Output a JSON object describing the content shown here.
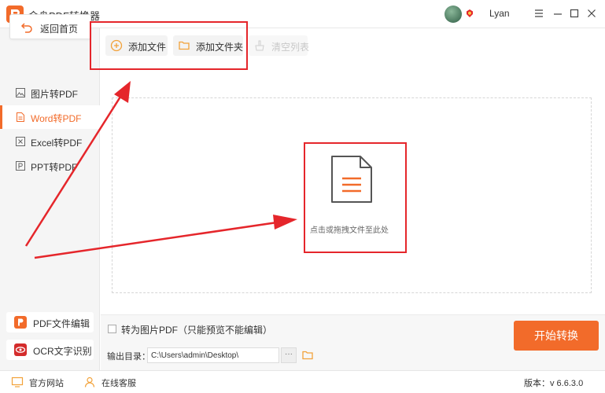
{
  "app": {
    "title": "金舟PDF转换器",
    "user": "Lyan",
    "version_label": "版本：",
    "version": "v 6.6.3.0"
  },
  "sidebar": {
    "back": "返回首页",
    "items": [
      {
        "label": "图片转PDF",
        "icon": "image-icon"
      },
      {
        "label": "Word转PDF",
        "icon": "word-doc-icon",
        "active": true
      },
      {
        "label": "Excel转PDF",
        "icon": "excel-icon"
      },
      {
        "label": "PPT转PDF",
        "icon": "ppt-icon"
      }
    ],
    "tools": [
      {
        "label": "PDF文件编辑",
        "icon": "pdf-edit-icon"
      },
      {
        "label": "OCR文字识别",
        "icon": "ocr-eye-icon"
      }
    ]
  },
  "toolbar": {
    "add_file": "添加文件",
    "add_folder": "添加文件夹",
    "clear_list": "清空列表"
  },
  "drop": {
    "text": "点击或拖拽文件至此处"
  },
  "options": {
    "to_image_pdf": "转为图片PDF（只能预览不能编辑）",
    "output_label": "输出目录：",
    "output_path": "C:\\Users\\admin\\Desktop\\",
    "browse": "···",
    "start": "开始转换"
  },
  "status": {
    "website": "官方网站",
    "support": "在线客服"
  },
  "colors": {
    "accent": "#f26b2a",
    "annotation": "#e5262b"
  }
}
